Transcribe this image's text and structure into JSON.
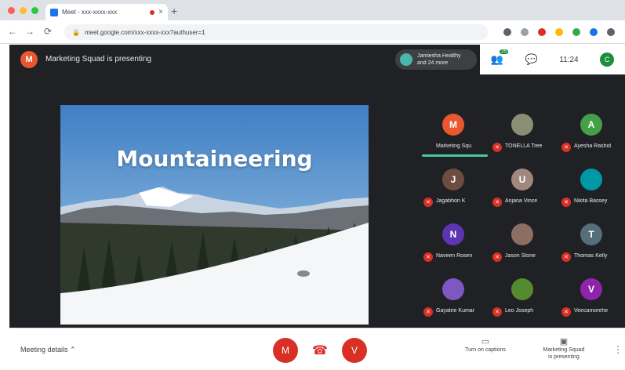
{
  "browser": {
    "tab_title": "Meet - xxx-xxxx-xxx",
    "url": "meet.google.com/xxx-xxxx-xxx?authuser=1",
    "new_tab": "+",
    "close": "×",
    "nav": [
      "←",
      "→",
      "⟳"
    ]
  },
  "meet": {
    "presenter_initial": "M",
    "presenting_text": "Marketing Squad is presenting",
    "self_chip": [
      "Jamiesha Healthy",
      "and 24 more"
    ],
    "people_count": "25",
    "time": "11:24",
    "self_initial": "C"
  },
  "slide": {
    "title": "Mountaineering"
  },
  "participants": [
    {
      "name": "Marketing Squ",
      "initial": "M",
      "color": "#e8572e",
      "active": true
    },
    {
      "name": "TONELLA Tree",
      "initial": "",
      "color": "#8a8f74",
      "active": false
    },
    {
      "name": "Ayesha Rashid",
      "initial": "A",
      "color": "#43a047",
      "active": false
    },
    {
      "name": "Jagabhon K",
      "initial": "J",
      "color": "#6d4c41",
      "active": false
    },
    {
      "name": "Anjana Vince",
      "initial": "U",
      "color": "#a1887f",
      "active": false
    },
    {
      "name": "Nikita Bassey",
      "initial": "",
      "color": "#0097a7",
      "active": false
    },
    {
      "name": "Naveen Rosen",
      "initial": "N",
      "color": "#5e35b1",
      "active": false
    },
    {
      "name": "Jason Stone",
      "initial": "",
      "color": "#8d6e63",
      "active": false
    },
    {
      "name": "Thomas Kelly",
      "initial": "T",
      "color": "#546e7a",
      "active": false
    },
    {
      "name": "Gayatrie Kumar",
      "initial": "",
      "color": "#7e57c2",
      "active": false
    },
    {
      "name": "Leo Joseph",
      "initial": "",
      "color": "#558b2f",
      "active": false
    },
    {
      "name": "Veecamorehe",
      "initial": "V",
      "color": "#8e24aa",
      "active": false
    }
  ],
  "bottom": {
    "meeting_details": "Meeting details",
    "mic_glyph": "M",
    "cam_glyph": "V",
    "captions": "Turn on captions",
    "presenting_action": [
      "Marketing Squad",
      "is presenting"
    ]
  },
  "colors": {
    "accent_red": "#d93025",
    "underline": "#4cc9a4",
    "dark_bg": "#202124"
  }
}
